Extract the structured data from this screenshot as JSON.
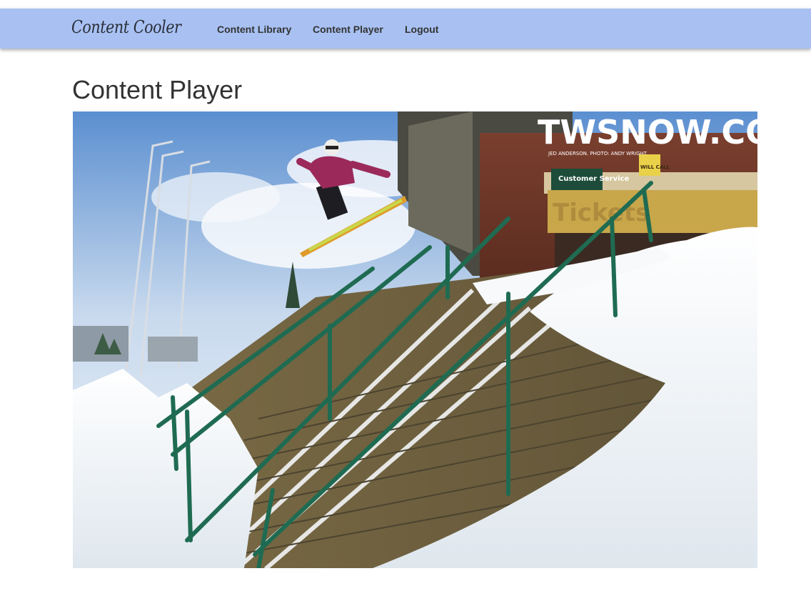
{
  "navbar": {
    "brand": "Content Cooler",
    "links": [
      "Content Library",
      "Content Player",
      "Logout"
    ]
  },
  "page": {
    "title": "Content Player"
  },
  "player": {
    "image": {
      "watermark": "TWSNOW.COM",
      "credit": "JED ANDERSON. PHOTO: ANDY WRIGHT",
      "signs": {
        "customer_service": "Customer Service",
        "will_call": "WILL CALL",
        "tickets": "Tickets"
      }
    }
  }
}
